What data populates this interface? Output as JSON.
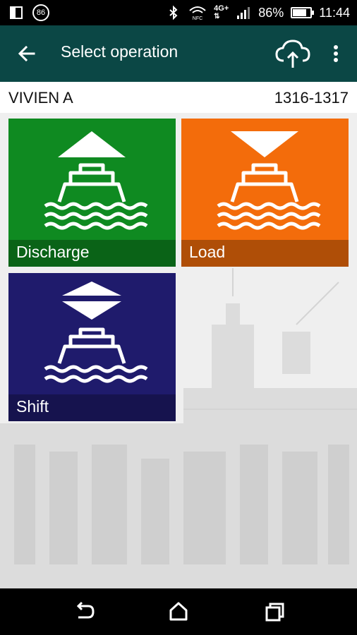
{
  "status_bar": {
    "notification_badge": "86",
    "network_type": "4G+",
    "battery_percent_text": "86%",
    "battery_level": 0.86,
    "time": "11:44",
    "icons": [
      "screen-icon",
      "notification-86-icon",
      "bluetooth-icon",
      "nfc-wifi-icon",
      "network-4g-icon",
      "signal-icon",
      "battery-icon"
    ]
  },
  "app_bar": {
    "title": "Select operation",
    "back_icon": "back-arrow-icon",
    "sync_icon": "cloud-upload-icon",
    "more_icon": "more-vert-icon",
    "background": "#0b4745"
  },
  "vessel": {
    "name": "VIVIEN A",
    "voyage": "1316-1317"
  },
  "operations": [
    {
      "label": "Discharge",
      "color": "#0f8a21",
      "icon": "ship-discharge-icon"
    },
    {
      "label": "Load",
      "color": "#f36c0b",
      "icon": "ship-load-icon"
    },
    {
      "label": "Shift",
      "color": "#1f1b6c",
      "icon": "ship-shift-icon"
    }
  ],
  "nav_bar": {
    "buttons": [
      "back-nav-icon",
      "home-nav-icon",
      "recents-nav-icon"
    ]
  }
}
